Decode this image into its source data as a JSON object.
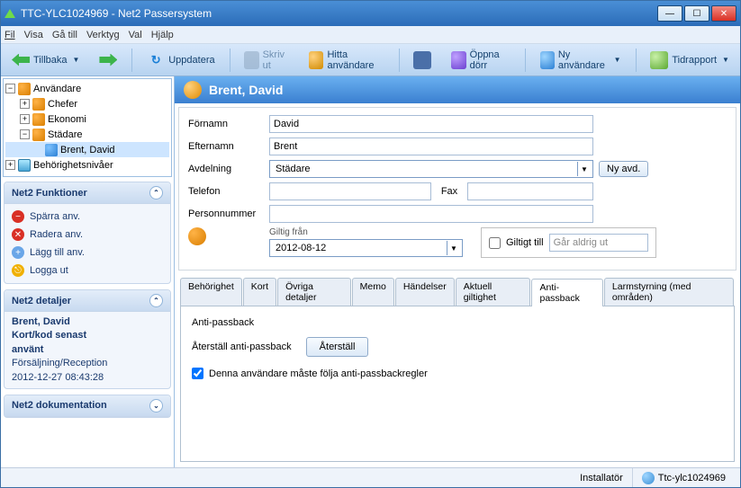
{
  "window": {
    "title": "TTC-YLC1024969 - Net2 Passersystem"
  },
  "menu": {
    "file": "Fil",
    "view": "Visa",
    "goto": "Gå till",
    "tools": "Verktyg",
    "options": "Val",
    "help": "Hjälp"
  },
  "toolbar": {
    "back": "Tillbaka",
    "refresh": "Uppdatera",
    "print": "Skriv ut",
    "find": "Hitta användare",
    "opendoor": "Öppna dörr",
    "newuser": "Ny användare",
    "timesheet": "Tidrapport"
  },
  "tree": {
    "users": "Användare",
    "nodes": [
      {
        "label": "Chefer"
      },
      {
        "label": "Ekonomi"
      },
      {
        "label": "Städare",
        "expanded": true,
        "children": [
          {
            "label": "Brent, David"
          }
        ]
      }
    ],
    "levels": "Behörighetsnivåer"
  },
  "side": {
    "functions": {
      "title": "Net2 Funktioner",
      "block": "Spärra anv.",
      "delete": "Radera anv.",
      "add": "Lägg till anv.",
      "logout": "Logga ut"
    },
    "details": {
      "title": "Net2 detaljer",
      "name": "Brent, David",
      "sub1": "Kort/kod senast",
      "sub2": "använt",
      "sub3": "Försäljning/Reception",
      "time": "2012-12-27 08:43:28"
    },
    "docs": {
      "title": "Net2 dokumentation"
    }
  },
  "user": {
    "header": "Brent, David",
    "labels": {
      "firstname": "Förnamn",
      "surname": "Efternamn",
      "dept": "Avdelning",
      "phone": "Telefon",
      "fax": "Fax",
      "empno": "Personnummer",
      "validfrom": "Giltig från",
      "validto": "Giltigt till",
      "neverexp": "Går aldrig ut",
      "newdept": "Ny avd."
    },
    "values": {
      "firstname": "David",
      "surname": "Brent",
      "dept": "Städare",
      "validfrom": "2012-08-12"
    }
  },
  "tabs": {
    "access": "Behörighet",
    "cards": "Kort",
    "other": "Övriga detaljer",
    "memo": "Memo",
    "events": "Händelser",
    "validity": "Aktuell giltighet",
    "antipassback": "Anti-passback",
    "alarm": "Larmstyrning (med områden)"
  },
  "apb": {
    "section": "Anti-passback",
    "resetlabel": "Återställ anti-passback",
    "resetbtn": "Återställ",
    "followrules": "Denna användare måste följa anti-passbackregler"
  },
  "status": {
    "role": "Installatör",
    "machine": "Ttc-ylc1024969"
  }
}
